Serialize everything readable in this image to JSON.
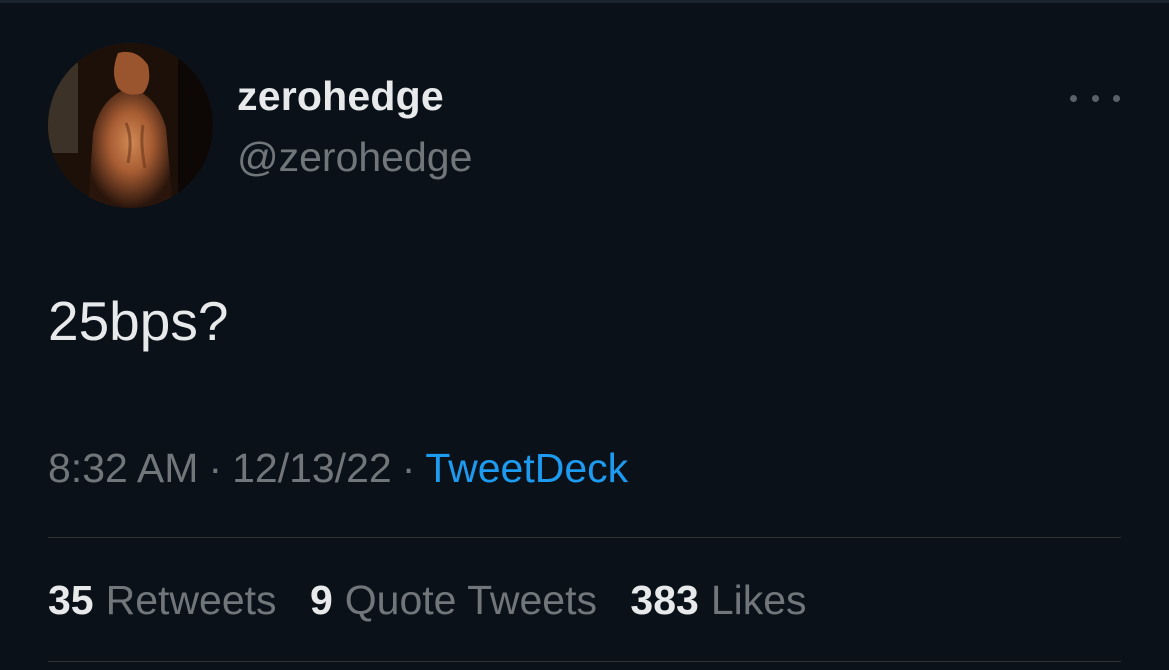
{
  "tweet": {
    "author": {
      "display_name": "zerohedge",
      "handle": "@zerohedge"
    },
    "more_icon": "more-horizontal-icon",
    "text": "25bps?",
    "time": "8:32 AM",
    "date": "12/13/22",
    "separator": "·",
    "source": "TweetDeck",
    "stats": [
      {
        "count": "35",
        "label": "Retweets"
      },
      {
        "count": "9",
        "label": "Quote Tweets"
      },
      {
        "count": "383",
        "label": "Likes"
      }
    ]
  },
  "colors": {
    "background": "#0a1118",
    "primary_text": "#e7e9ea",
    "secondary_text": "#71767b",
    "link": "#1d9bf0",
    "divider": "#2f3336"
  }
}
